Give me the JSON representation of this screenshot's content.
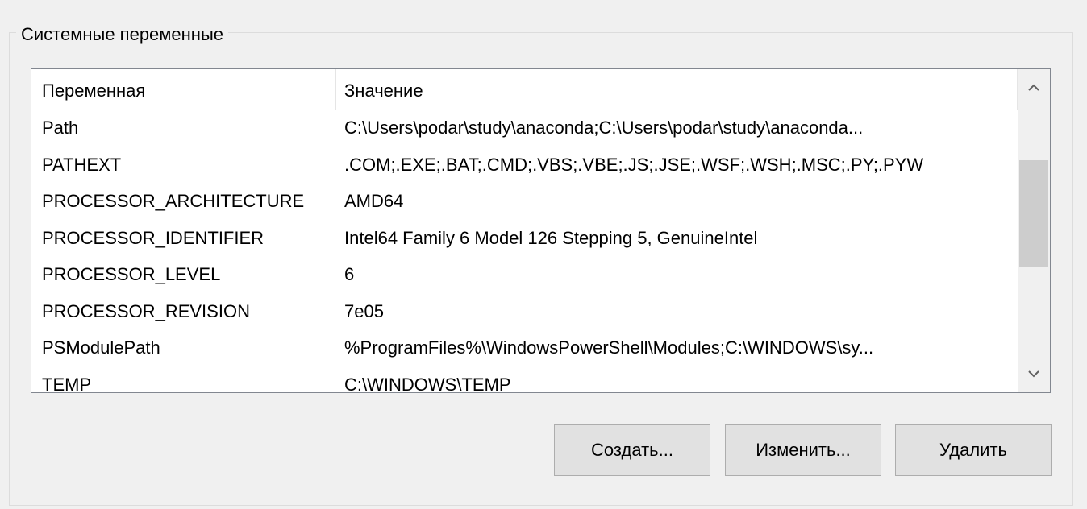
{
  "group": {
    "title": "Системные переменные"
  },
  "list": {
    "columns": [
      "Переменная",
      "Значение"
    ],
    "rows": [
      {
        "name": "Path",
        "value": "C:\\Users\\podar\\study\\anaconda;C:\\Users\\podar\\study\\anaconda..."
      },
      {
        "name": "PATHEXT",
        "value": ".COM;.EXE;.BAT;.CMD;.VBS;.VBE;.JS;.JSE;.WSF;.WSH;.MSC;.PY;.PYW"
      },
      {
        "name": "PROCESSOR_ARCHITECTURE",
        "value": "AMD64"
      },
      {
        "name": "PROCESSOR_IDENTIFIER",
        "value": "Intel64 Family 6 Model 126 Stepping 5, GenuineIntel"
      },
      {
        "name": "PROCESSOR_LEVEL",
        "value": "6"
      },
      {
        "name": "PROCESSOR_REVISION",
        "value": "7e05"
      },
      {
        "name": "PSModulePath",
        "value": "%ProgramFiles%\\WindowsPowerShell\\Modules;C:\\WINDOWS\\sy..."
      },
      {
        "name": "TEMP",
        "value": "C:\\WINDOWS\\TEMP"
      }
    ]
  },
  "scrollbar": {
    "position_fraction": 0.38,
    "visible_fraction": 0.43,
    "up_icon": "chevron-up-icon",
    "down_icon": "chevron-down-icon"
  },
  "buttons": {
    "create": "Создать...",
    "edit": "Изменить...",
    "delete": "Удалить"
  },
  "colors": {
    "window_bg": "#f0f0f0",
    "list_bg": "#ffffff",
    "button_bg": "#e1e1e1",
    "scroll_thumb": "#cdcdcd"
  }
}
